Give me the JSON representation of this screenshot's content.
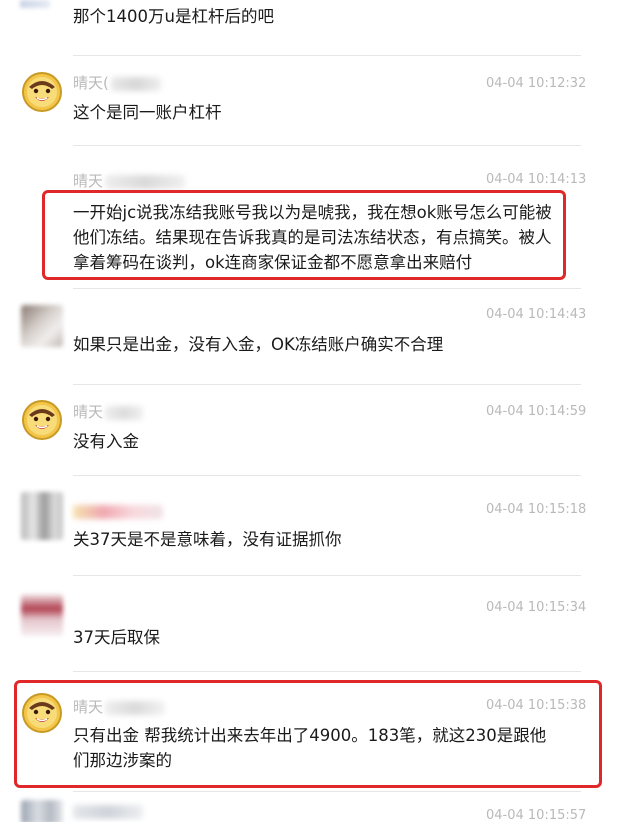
{
  "colors": {
    "highlight": "#e0282a",
    "meta_text": "#b9b9b9",
    "body_text": "#1a1a1a"
  },
  "messages": [
    {
      "sender": "",
      "time": "",
      "text": "那个1400万u是杠杆后的吧",
      "avatar_icon": "blurred-avatar-icon"
    },
    {
      "sender": "晴天(",
      "time": "04-04 10:12:32",
      "text": "这个是同一账户杠杆",
      "avatar_icon": "smiley-face-avatar-icon"
    },
    {
      "sender": "晴天",
      "time": "04-04 10:14:13",
      "text": "一开始jc说我冻结我账号我以为是唬我，我在想ok账号怎么可能被他们冻结。结果现在告诉我真的是司法冻结状态，有点搞笑。被人拿着筹码在谈判，ok连商家保证金都不愿意拿出来赔付",
      "avatar_icon": "none"
    },
    {
      "sender": "",
      "time": "04-04 10:14:43",
      "text": "如果只是出金，没有入金，OK冻结账户确实不合理",
      "avatar_icon": "blurred-avatar-icon"
    },
    {
      "sender": "晴天",
      "time": "04-04 10:14:59",
      "text": "没有入金",
      "avatar_icon": "smiley-face-avatar-icon"
    },
    {
      "sender": "",
      "time": "04-04 10:15:18",
      "text": "关37天是不是意味着，没有证据抓你",
      "avatar_icon": "blurred-avatar-icon"
    },
    {
      "sender": "",
      "time": "04-04 10:15:34",
      "text": "37天后取保",
      "avatar_icon": "blurred-avatar-icon"
    },
    {
      "sender": "晴天",
      "time": "04-04 10:15:38",
      "text": "只有出金 帮我统计出来去年出了4900。183笔，就这230是跟他们那边涉案的",
      "avatar_icon": "smiley-face-avatar-icon"
    },
    {
      "sender": "",
      "time": "04-04 10:15:57",
      "text": "",
      "avatar_icon": "blurred-avatar-icon"
    }
  ]
}
